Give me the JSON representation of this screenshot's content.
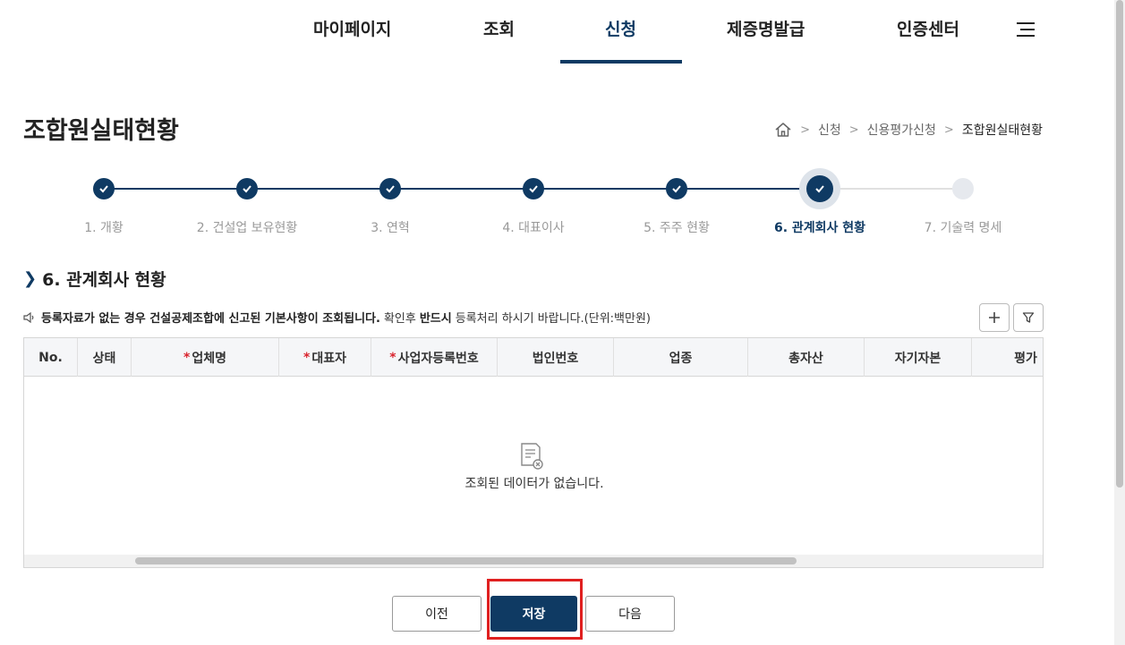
{
  "nav": {
    "items": [
      "마이페이지",
      "조회",
      "신청",
      "제증명발급",
      "인증센터"
    ],
    "active_index": 2
  },
  "page": {
    "title": "조합원실태현황"
  },
  "breadcrumb": {
    "items": [
      "신청",
      "신용평가신청",
      "조합원실태현황"
    ]
  },
  "steps": {
    "labels": [
      "1. 개황",
      "2. 건설업 보유현황",
      "3. 연혁",
      "4. 대표이사",
      "5. 주주 현황",
      "6. 관계회사 현황",
      "7. 기술력 명세"
    ],
    "current_index": 5
  },
  "section": {
    "title": "6. 관계회사 현황"
  },
  "notice": {
    "bold_1": "등록자료가 없는 경우 건설공제조합에 신고된 기본사항이 조회됩니다.",
    "text_1": "확인후",
    "bold_2": "반드시",
    "text_2": "등록처리 하시기 바랍니다.(단위:백만원)"
  },
  "grid": {
    "columns": [
      {
        "label": "No.",
        "required": false
      },
      {
        "label": "상태",
        "required": false
      },
      {
        "label": "업체명",
        "required": true
      },
      {
        "label": "대표자",
        "required": true
      },
      {
        "label": "사업자등록번호",
        "required": true
      },
      {
        "label": "법인번호",
        "required": false
      },
      {
        "label": "업종",
        "required": false
      },
      {
        "label": "총자산",
        "required": false
      },
      {
        "label": "자기자본",
        "required": false
      },
      {
        "label": "평가",
        "required": false
      }
    ],
    "required_mark": "*",
    "empty_message": "조회된 데이터가 없습니다."
  },
  "buttons": {
    "prev": "이전",
    "save": "저장",
    "next": "다음"
  },
  "colors": {
    "primary": "#0f3a63",
    "highlight": "#e02020",
    "required": "#d9232d"
  }
}
